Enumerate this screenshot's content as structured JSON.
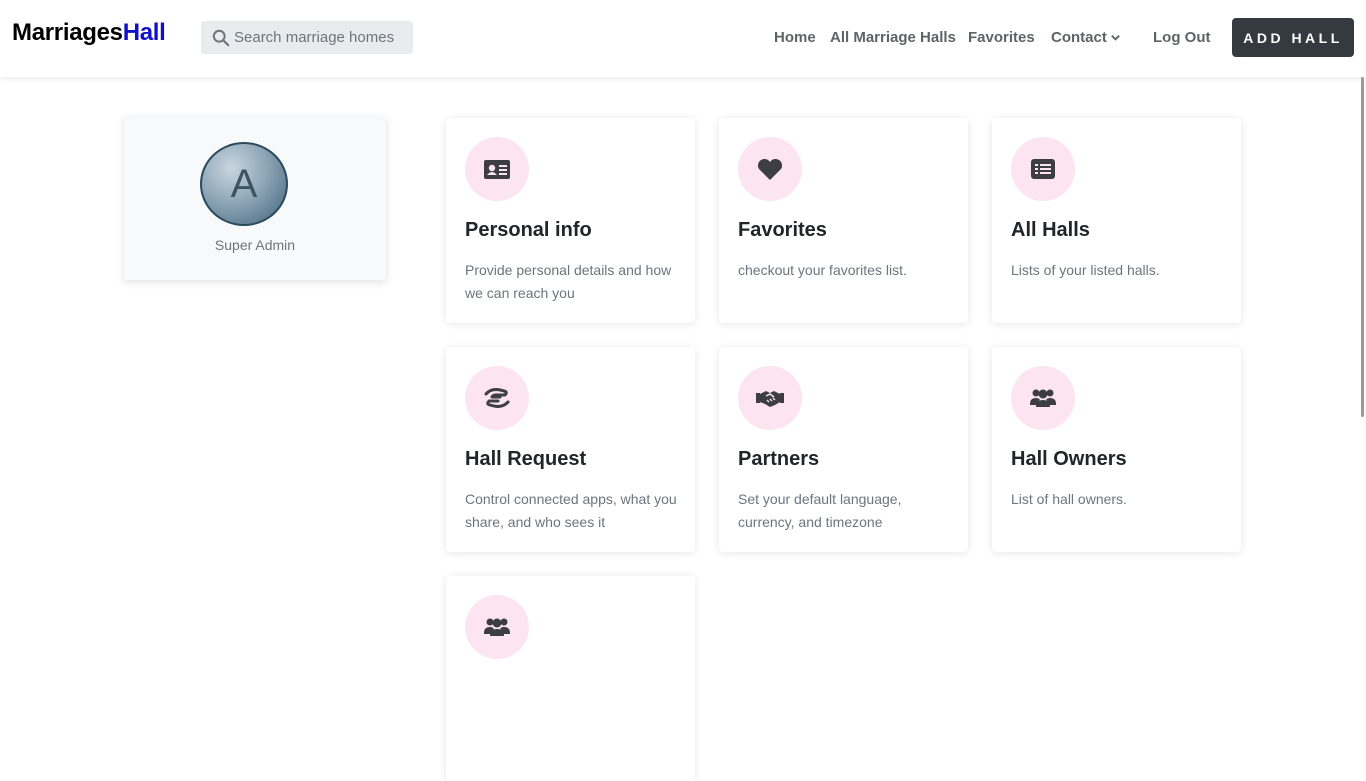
{
  "brand": {
    "part1": "Marriages",
    "part2": "Hall",
    "accent_color": "#1010c8"
  },
  "search": {
    "placeholder": "Search marriage homes"
  },
  "nav": {
    "links": [
      "Home",
      "All Marriage Halls",
      "Favorites",
      "Contact",
      "Log Out"
    ],
    "add_button": "ADD HALL"
  },
  "profile": {
    "initial": "A",
    "role": "Super Admin"
  },
  "cards": [
    {
      "icon": "id-card-icon",
      "title": "Personal info",
      "desc": "Provide personal details and how we can reach you"
    },
    {
      "icon": "heart-icon",
      "title": "Favorites",
      "desc": "checkout your favorites list."
    },
    {
      "icon": "list-icon",
      "title": "All Halls",
      "desc": "Lists of your listed halls."
    },
    {
      "icon": "hand-holding-icon",
      "title": "Hall Request",
      "desc": "Control connected apps, what you share, and who sees it"
    },
    {
      "icon": "handshake-icon",
      "title": "Partners",
      "desc": "Set your default language, currency, and timezone"
    },
    {
      "icon": "users-icon",
      "title": "Hall Owners",
      "desc": "List of hall owners."
    },
    {
      "icon": "users-icon",
      "title": "",
      "desc": ""
    }
  ],
  "colors": {
    "icon_bg": "#fce4f0",
    "icon_fg": "#3d3d46",
    "button_bg": "#343a40"
  }
}
